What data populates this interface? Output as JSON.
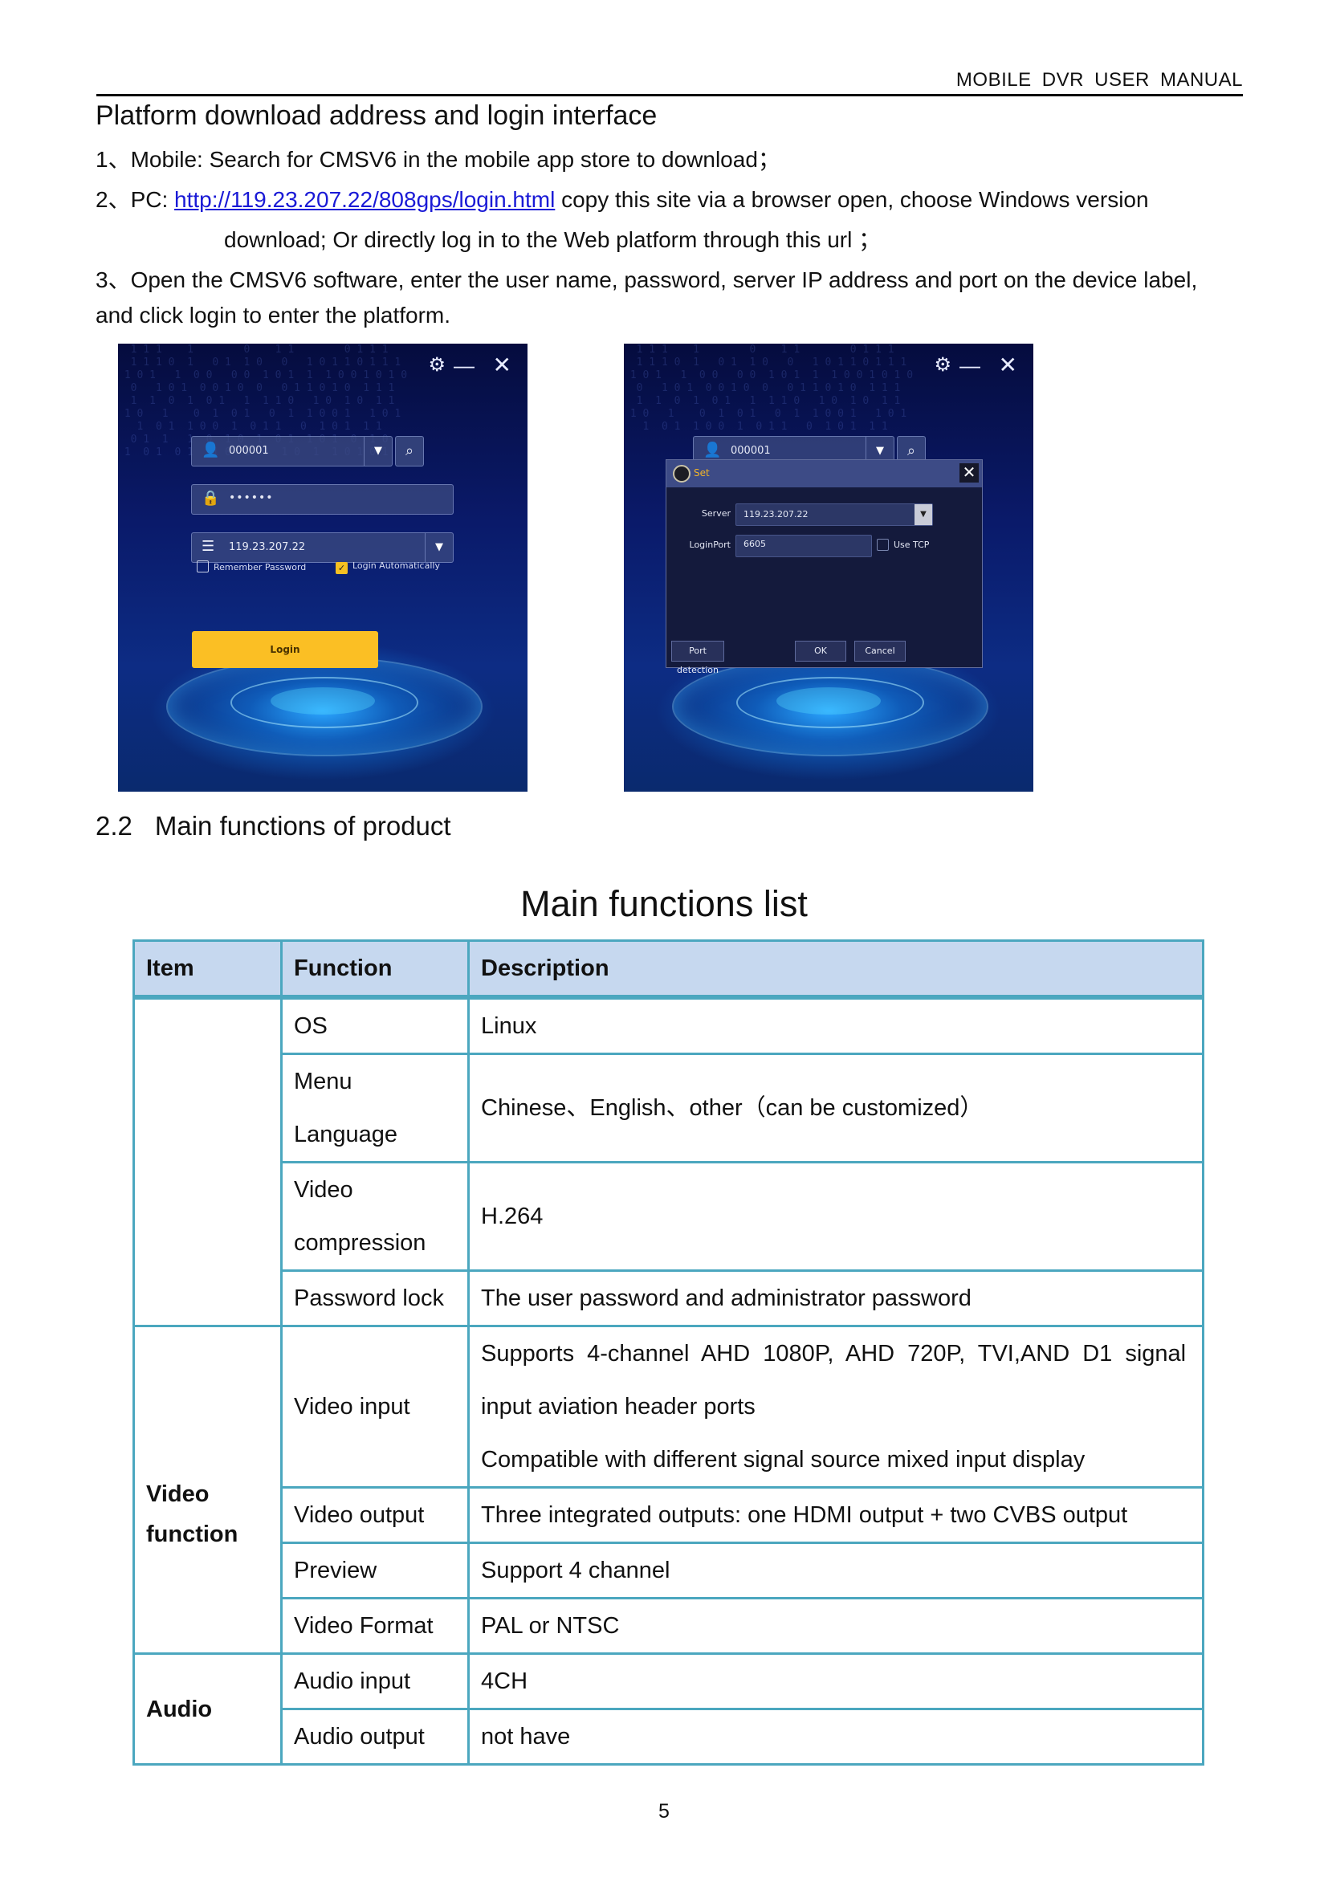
{
  "header": {
    "running_title": "MOBILE  DVR  USER  MANUAL"
  },
  "section": {
    "heading": "Platform download address and login interface",
    "items": [
      {
        "prefix": "1、",
        "text": "Mobile: Search for CMSV6 in the mobile app store to download；"
      },
      {
        "prefix": "2、",
        "text_before": "PC: ",
        "link": "http://119.23.207.22/808gps/login.html",
        "text_after": " copy this site via a browser open, choose Windows version",
        "continuation": "download;    Or directly log in to the Web platform through this url    ；"
      },
      {
        "prefix": "3、",
        "text": "Open the CMSV6 software, enter the user name, password, server IP address and port on the device label,",
        "continuation": "and click login to enter the platform."
      }
    ]
  },
  "login_screen": {
    "username": "000001",
    "password_mask": "••••••",
    "server": "119.23.207.22",
    "remember_password_label": "Remember Password",
    "remember_password_checked": false,
    "login_automatically_label": "Login Automatically",
    "login_automatically_checked": true,
    "login_button": "Login",
    "icons": {
      "settings": "gear-icon",
      "minimize": "minimize-icon",
      "close": "close-icon",
      "user": "user-icon",
      "lock": "lock-icon",
      "server": "server-icon",
      "search": "search-icon",
      "dropdown": "chevron-down-icon"
    }
  },
  "settings_screen": {
    "username": "000001",
    "dialog_title": "Set",
    "server_label": "Server",
    "server_value": "119.23.207.22",
    "login_port_label": "LoginPort",
    "login_port_value": "6605",
    "use_tcp_label": "Use TCP",
    "use_tcp_checked": false,
    "port_detection_button": "Port detection",
    "ok_button": "OK",
    "cancel_button": "Cancel"
  },
  "subsection": {
    "number": "2.2",
    "title": "Main functions of product"
  },
  "table": {
    "title": "Main functions list",
    "headers": [
      "Item",
      "Function",
      "Description"
    ],
    "groups": [
      {
        "item": "",
        "rows": [
          {
            "function": "OS",
            "description": "Linux"
          },
          {
            "function": "Menu Language",
            "function_lines": [
              "Menu",
              "Language"
            ],
            "description": "Chinese、English、other（can be customized）"
          },
          {
            "function": "Video compression",
            "function_lines": [
              "Video",
              "compression"
            ],
            "description": "H.264"
          },
          {
            "function": "Password lock",
            "description": "The user password and administrator password"
          }
        ]
      },
      {
        "item": "Video function",
        "item_lines": [
          "Video",
          "function"
        ],
        "rows": [
          {
            "function": "Video input",
            "description_lines": [
              "Supports 4-channel AHD 1080P, AHD 720P, TVI,AND D1 signal",
              "input aviation header ports",
              "Compatible with different signal source mixed input display"
            ]
          },
          {
            "function": "Video output",
            "description": "Three integrated outputs: one HDMI output + two CVBS output"
          },
          {
            "function": "Preview",
            "description": "Support 4 channel"
          },
          {
            "function": "Video Format",
            "description": "PAL or NTSC"
          }
        ]
      },
      {
        "item": "Audio",
        "rows": [
          {
            "function": "Audio input",
            "description": "4CH"
          },
          {
            "function": "Audio output",
            "description": "not have"
          }
        ]
      }
    ]
  },
  "page_number": "5",
  "colors": {
    "table_border": "#4ba7bf",
    "table_header_bg": "#c6d8ef",
    "link": "#1a1ad6",
    "login_button": "#fbbf24"
  }
}
